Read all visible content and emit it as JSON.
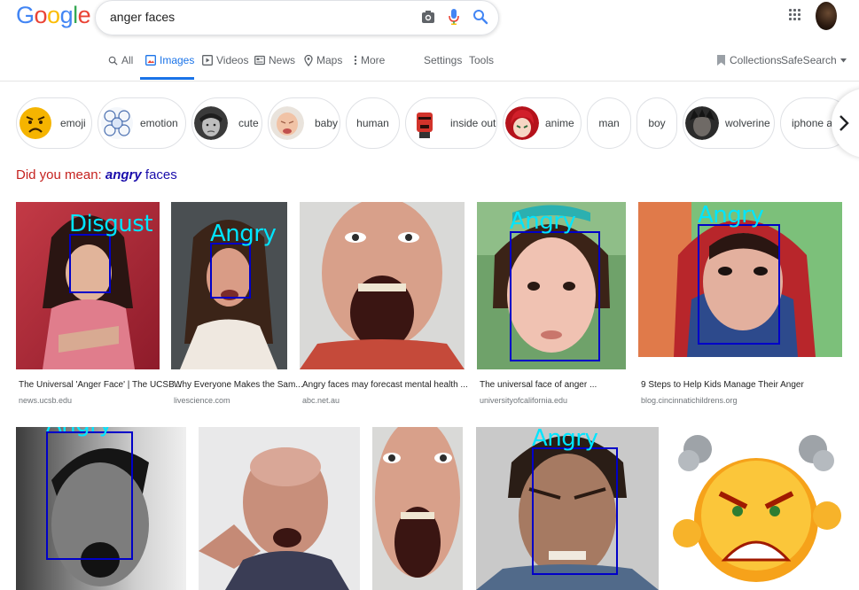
{
  "header": {
    "logo_letters": [
      "G",
      "o",
      "o",
      "g",
      "l",
      "e"
    ],
    "logo_colors": [
      "#4285F4",
      "#EA4335",
      "#FBBC05",
      "#4285F4",
      "#34A853",
      "#EA4335"
    ],
    "query": "anger faces",
    "icons": [
      "camera-icon",
      "mic-icon",
      "search-icon",
      "apps-icon"
    ]
  },
  "tabs": [
    {
      "label": "All",
      "icon": "search-icon"
    },
    {
      "label": "Images",
      "icon": "images-icon",
      "active": true
    },
    {
      "label": "Videos",
      "icon": "video-icon"
    },
    {
      "label": "News",
      "icon": "news-icon"
    },
    {
      "label": "Maps",
      "icon": "map-pin-icon"
    },
    {
      "label": "More",
      "icon": "more-vert-icon"
    }
  ],
  "tools": {
    "settings": "Settings",
    "tools": "Tools",
    "collections": "Collections",
    "safesearch": "SafeSearch"
  },
  "chips": [
    {
      "label": "emoji"
    },
    {
      "label": "emotion"
    },
    {
      "label": "cute"
    },
    {
      "label": "baby"
    },
    {
      "label": "human"
    },
    {
      "label": "inside out"
    },
    {
      "label": "anime"
    },
    {
      "label": "man"
    },
    {
      "label": "boy"
    },
    {
      "label": "wolverine"
    },
    {
      "label": "iphone an"
    }
  ],
  "did_you_mean": {
    "prefix": "Did you mean:",
    "word": "angry",
    "rest": "faces"
  },
  "results_row1": [
    {
      "title": "The Universal 'Anger Face' | The UCSB...",
      "source": "news.ucsb.edu",
      "detection": "Disgust"
    },
    {
      "title": "Why Everyone Makes the Sam...",
      "source": "livescience.com",
      "detection": "Angry"
    },
    {
      "title": "Angry faces may forecast mental health ...",
      "source": "abc.net.au",
      "detection": ""
    },
    {
      "title": "The universal face of anger ...",
      "source": "universityofcalifornia.edu",
      "detection": "Angry"
    },
    {
      "title": "9 Steps to Help Kids Manage Their Anger",
      "source": "blog.cincinnatichildrens.org",
      "detection": "Angry"
    }
  ],
  "results_row2": [
    {
      "detection": "Angry"
    },
    {
      "detection": ""
    },
    {
      "detection": ""
    },
    {
      "detection": "Angry"
    },
    {
      "detection": ""
    }
  ],
  "colors": {
    "accent": "#1a73e8",
    "detection_box": "#0000c8",
    "detection_label": "#00e5ff",
    "did_you_mean": "#c5221f",
    "link": "#1a0dab"
  }
}
